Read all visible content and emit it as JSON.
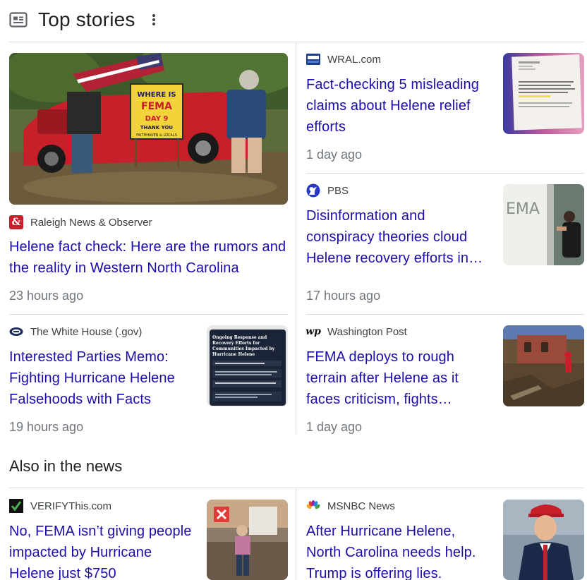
{
  "header": {
    "title": "Top stories",
    "icon": "newspaper-icon"
  },
  "section2": {
    "title": "Also in the news"
  },
  "colors": {
    "link": "#1a0dab",
    "meta": "#70757a",
    "divider": "#dadce0"
  },
  "stories": [
    {
      "source": "Raleigh News & Observer",
      "headline": "Helene fact check: Here are the rumors and the reality in Western North Carolina",
      "time": "23 hours ago",
      "image_text": [
        "WHERE IS",
        "FEMA",
        "DAY 9",
        "THANK YOU",
        "FAITHHAVEN & LOCALS"
      ]
    },
    {
      "source": "WRAL.com",
      "headline": "Fact-checking 5 misleading claims about Helene relief efforts",
      "time": "1 day ago"
    },
    {
      "source": "PBS",
      "headline": "Disinformation and conspiracy theories cloud Helene recovery efforts in…",
      "time": "17 hours ago",
      "image_text": "EMA"
    },
    {
      "source": "The White House (.gov)",
      "headline": "Interested Parties Memo: Fighting Hurricane Helene Falsehoods with Facts",
      "time": "19 hours ago",
      "image_text": "Ongoing Response and Recovery Efforts for Communities Impacted by Hurricane Helene"
    },
    {
      "source": "Washington Post",
      "headline": "FEMA deploys to rough terrain after Helene as it faces criticism, fights…",
      "time": "1 day ago"
    },
    {
      "source": "VERIFYThis.com",
      "headline": "No, FEMA isn’t giving people impacted by Hurricane Helene just $750"
    },
    {
      "source": "MSNBC News",
      "headline": "After Hurricane Helene, North Carolina needs help. Trump is offering lies."
    }
  ]
}
